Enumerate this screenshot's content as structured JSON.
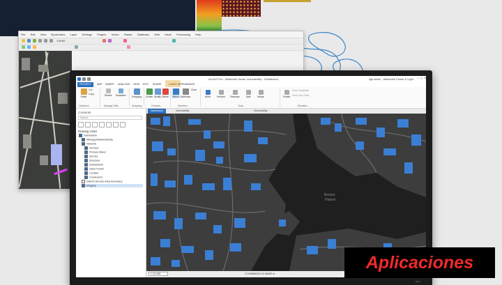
{
  "left_window": {
    "menu": [
      "File",
      "Edit",
      "View",
      "Bookmarks",
      "Layer",
      "Settings",
      "Plugins",
      "Vector",
      "Raster",
      "Database",
      "Web",
      "Mesh",
      "Processing",
      "Help"
    ],
    "zoom_value": "1:5000"
  },
  "main_window": {
    "title": "ArcGIS Pro - Waterville Sewer Vulnerability - Distribution",
    "user": "ligh.stoke - Waterville Power & Light",
    "tabs": [
      {
        "label": "PROJECT",
        "active": true
      },
      {
        "label": "MAP"
      },
      {
        "label": "INSERT"
      },
      {
        "label": "ANALYSIS"
      },
      {
        "label": "VIEW"
      },
      {
        "label": "EDIT"
      },
      {
        "label": "SHARE"
      },
      {
        "label": "APPEARANCE"
      }
    ],
    "context_tab": "LinkOS",
    "ribbon": {
      "buttons": [
        "Cut",
        "Copy",
        "Paste",
        "Templates",
        "Sheets",
        "Snapping",
        "Create",
        "Modify",
        "Delete",
        "Select",
        "Attributes",
        "Clear",
        "Move",
        "Vertices",
        "Reshape",
        "Split",
        "Merge",
        "Enable",
        "Clear Templates",
        "Clear Dirty Data"
      ],
      "groups": [
        "Clipboard",
        "Manage Edits",
        "Snapping",
        "Features",
        "Selection",
        "Tools",
        "Elevation"
      ]
    },
    "contents": {
      "title": "Contents",
      "search_placeholder": "Search",
      "drawing_order": "Drawing Order",
      "layers": [
        {
          "name": "Distribution",
          "checked": true
        },
        {
          "name": "ManagedNetworkData",
          "checked": true
        },
        {
          "name": "Network",
          "checked": true
        },
        {
          "name": "Devices",
          "checked": true
        },
        {
          "name": "Primary Meter",
          "checked": true
        },
        {
          "name": "Service",
          "checked": true
        },
        {
          "name": "Structure",
          "checked": true
        },
        {
          "name": "Subnetwork",
          "checked": true
        },
        {
          "name": "Open Points",
          "checked": true
        },
        {
          "name": "Conduit",
          "checked": true
        },
        {
          "name": "Conductors",
          "checked": true
        },
        {
          "name": "District Service Area Boundary",
          "checked": false
        },
        {
          "name": "Imagery",
          "checked": true,
          "selected": true
        }
      ]
    },
    "view_tabs": [
      {
        "label": "Distribution",
        "active": true
      },
      {
        "label": "Vulnerability"
      },
      {
        "label": "Vulnerability"
      }
    ],
    "map": {
      "water_label_line1": "Boston",
      "water_label_line2": "Harbor",
      "colors": {
        "land": "#3d3d3d",
        "water": "#1f1f1f",
        "buildings": "#3a7fd4",
        "roads": "#6c6c6c"
      }
    },
    "status": {
      "scale": "1:10,466",
      "coords": "-71.0598963W 42.3605E m"
    },
    "bezel_brand": "DELL"
  },
  "banner": {
    "label": "Aplicaciones",
    "colors": {
      "background": "#000000",
      "text": "#f02a2a"
    }
  }
}
